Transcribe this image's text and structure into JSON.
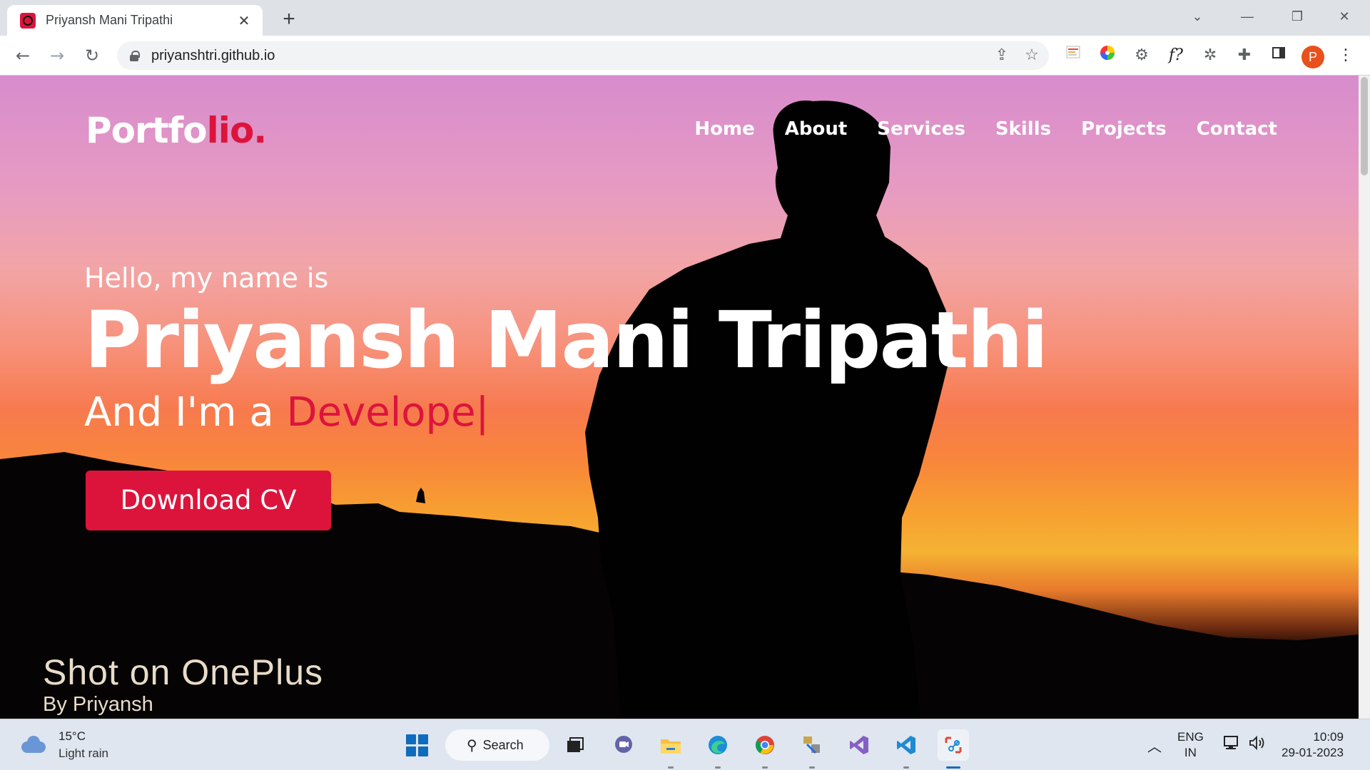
{
  "browser": {
    "tab_title": "Priyansh Mani Tripathi",
    "tab_close": "✕",
    "new_tab": "+",
    "url": "priyanshtri.github.io",
    "window_controls": {
      "chevron": "⌄",
      "minimize": "—",
      "restore": "❐",
      "close": "✕"
    },
    "profile_initial": "P",
    "extensions": [
      "list-extension-icon",
      "color-wheel-icon",
      "gear-badge-icon",
      "font-finder-icon",
      "bug-icon",
      "puzzle-icon",
      "sidepanel-icon"
    ],
    "font_finder_label": "f?",
    "menu": "⋮"
  },
  "site": {
    "logo_main": "Portfo",
    "logo_accent": "lio.",
    "nav": [
      "Home",
      "About",
      "Services",
      "Skills",
      "Projects",
      "Contact"
    ],
    "hero": {
      "greeting": "Hello, my name is",
      "name": "Priyansh Mani Tripathi",
      "role_prefix": "And I'm a ",
      "role_typed": "Develope",
      "cursor": "|",
      "cta": "Download CV"
    },
    "watermark": {
      "line1": "Shot on OnePlus",
      "line2": "By Priyansh"
    },
    "colors": {
      "accent": "#dc143c"
    }
  },
  "taskbar": {
    "weather_temp": "15°C",
    "weather_desc": "Light rain",
    "search_label": "Search",
    "lang_line1": "ENG",
    "lang_line2": "IN",
    "time": "10:09",
    "date": "29-01-2023",
    "tray_chevron": "︿"
  }
}
